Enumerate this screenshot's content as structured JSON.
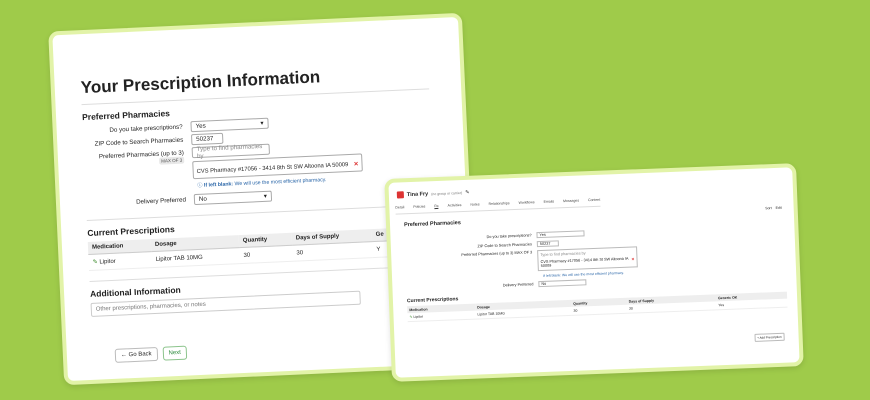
{
  "left": {
    "title": "Your Prescription Information",
    "preferred_section": "Preferred Pharmacies",
    "take_rx_label": "Do you take prescriptions?",
    "take_rx_value": "Yes",
    "zip_label": "ZIP Code to Search Pharmacies",
    "zip_value": "50237",
    "pharm_label": "Preferred Pharmacies (up to 3)",
    "pharm_placeholder": "Type to find pharmacies by",
    "max_tag": "MAX OF 3",
    "pharm_selected": "CVS Pharmacy #17056 - 3414 8th St SW Altoona IA 50009",
    "hint_bold": "If left blank:",
    "hint_text": "We will use the most efficient pharmacy.",
    "delivery_label": "Delivery Preferred",
    "delivery_value": "No",
    "current_section": "Current Prescriptions",
    "table_headers": [
      "Medication",
      "Dosage",
      "Quantity",
      "Days of Supply",
      "Ge"
    ],
    "table_rows": [
      [
        "Lipitor",
        "Lipitor TAB 10MG",
        "30",
        "30",
        "Y"
      ]
    ],
    "additional_section": "Additional Information",
    "notes_placeholder": "Other prescriptions, pharmacies, or notes",
    "back_label": "Go Back",
    "next_label": "Next"
  },
  "right": {
    "name": "Tina Fry",
    "sub": "(no group or carrier)",
    "tabs": [
      "Detail",
      "Policies",
      "Rx",
      "Activities",
      "Notes",
      "Relationships",
      "Workflows",
      "Emails",
      "Messages",
      "Content"
    ],
    "right_controls": [
      "Sort",
      "Edit"
    ],
    "section": "Preferred Pharmacies",
    "take_rx_label": "Do you take prescriptions?",
    "take_rx_value": "Yes",
    "zip_label": "ZIP Code to Search Pharmacies",
    "zip_value": "50237",
    "pharm_label": "Preferred Pharmacies (up to 3) MAX OF 3",
    "pharm_placeholder": "Type to find pharmacies by",
    "pharm_selected": "CVS Pharmacy #17056 - 3414 8th St SW Altoona IA 50009",
    "hint": "If left blank: We will use the most efficient pharmacy.",
    "delivery_label": "Delivery Preferred",
    "delivery_value": "No",
    "current_section": "Current Prescriptions",
    "table_headers": [
      "Medication",
      "Dosage",
      "Quantity",
      "Days of Supply",
      "Generic OK"
    ],
    "table_rows": [
      [
        "Lipitor",
        "Lipitor TAB 10MG",
        "30",
        "30",
        "Yes"
      ]
    ],
    "add_btn": "+ Add Prescription"
  }
}
